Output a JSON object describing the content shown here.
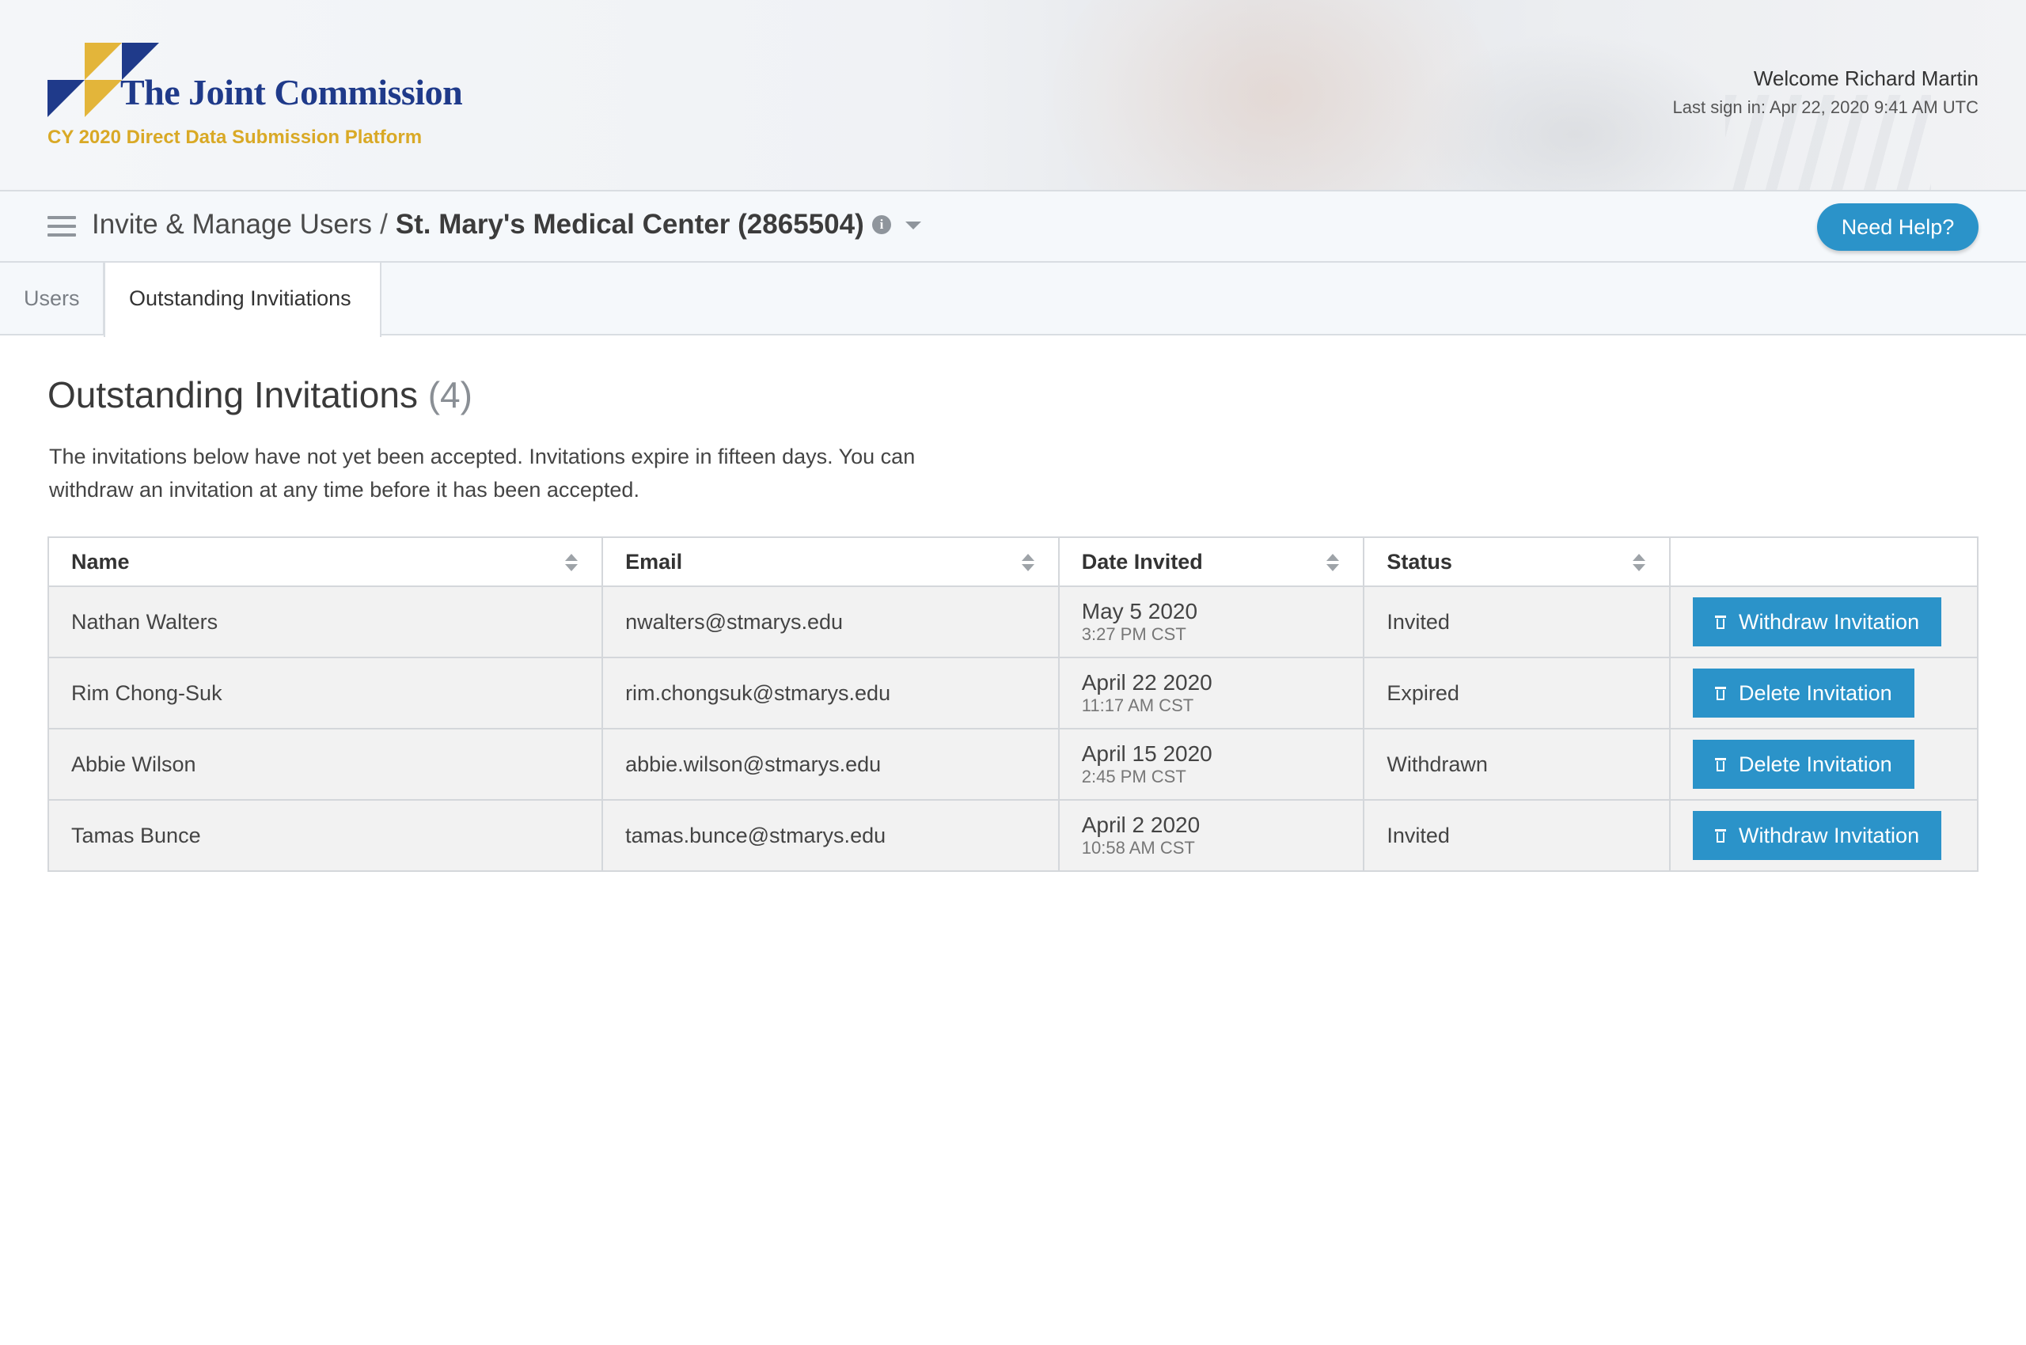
{
  "header": {
    "org_name": "The Joint Commission",
    "platform": "CY 2020 Direct Data Submission Platform",
    "welcome": "Welcome Richard Martin",
    "last_sign_in": "Last sign in: Apr 22, 2020 9:41 AM UTC"
  },
  "titlebar": {
    "section": "Invite & Manage Users",
    "separator": "/",
    "organization": "St. Mary's Medical Center (2865504)",
    "info_glyph": "i",
    "help_label": "Need Help?"
  },
  "tabs": [
    {
      "label": "Users",
      "active": false
    },
    {
      "label": "Outstanding Invitiations",
      "active": true
    }
  ],
  "main": {
    "heading": "Outstanding Invitations",
    "count": "(4)",
    "description": "The invitations below have not yet been accepted. Invitations expire in fifteen days. You can withdraw an invitation at any time before it has been accepted."
  },
  "table": {
    "columns": [
      "Name",
      "Email",
      "Date Invited",
      "Status",
      ""
    ],
    "rows": [
      {
        "name": "Nathan Walters",
        "email": "nwalters@stmarys.edu",
        "date": "May 5 2020",
        "time": "3:27 PM CST",
        "status": "Invited",
        "action": "Withdraw Invitation"
      },
      {
        "name": "Rim Chong-Suk",
        "email": "rim.chongsuk@stmarys.edu",
        "date": "April 22 2020",
        "time": "11:17 AM CST",
        "status": "Expired",
        "action": "Delete Invitation"
      },
      {
        "name": "Abbie Wilson",
        "email": "abbie.wilson@stmarys.edu",
        "date": "April 15 2020",
        "time": "2:45 PM CST",
        "status": "Withdrawn",
        "action": "Delete Invitation"
      },
      {
        "name": "Tamas Bunce",
        "email": "tamas.bunce@stmarys.edu",
        "date": "April 2 2020",
        "time": "10:58 AM CST",
        "status": "Invited",
        "action": "Withdraw Invitation"
      }
    ]
  },
  "icons": {
    "menu": "hamburger-menu-icon",
    "info": "info-circle-icon",
    "dropdown": "caret-down-icon",
    "sort": "sort-arrows-icon",
    "action": "trash-icon"
  },
  "colors": {
    "brand_navy": "#1f3a8a",
    "brand_gold": "#d9a926",
    "accent_blue": "#2b93c9"
  }
}
